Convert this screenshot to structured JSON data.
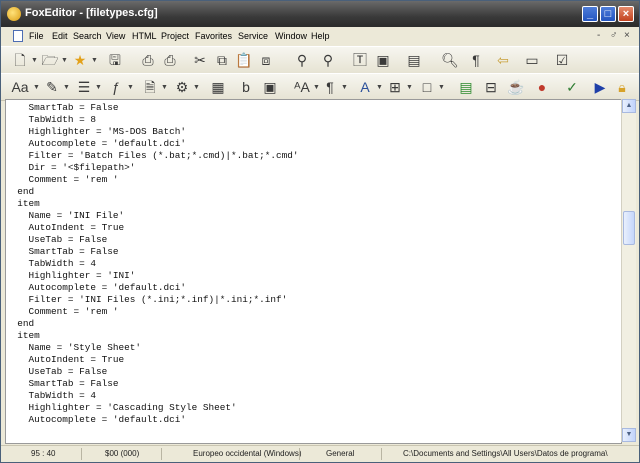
{
  "window": {
    "title": "FoxEditor - [filetypes.cfg]",
    "minimize_glyph": "_",
    "maximize_glyph": "□",
    "close_glyph": "×"
  },
  "menu": {
    "items": [
      "File",
      "Edit",
      "Search",
      "View",
      "HTML",
      "Project",
      "Favorites",
      "Service",
      "Window",
      "Help"
    ],
    "mdi_controls": [
      "-",
      "♂",
      "×"
    ]
  },
  "editor": {
    "lines": [
      "    SmartTab = False",
      "    TabWidth = 8",
      "    Highlighter = 'MS-DOS Batch'",
      "    Autocomplete = 'default.dci'",
      "    Filter = 'Batch Files (*.bat;*.cmd)|*.bat;*.cmd'",
      "    Dir = '<$filepath>'",
      "    Comment = 'rem '",
      "  end",
      "  item",
      "    Name = 'INI File'",
      "    AutoIndent = True",
      "    UseTab = False",
      "    SmartTab = False",
      "    TabWidth = 4",
      "    Highlighter = 'INI'",
      "    Autocomplete = 'default.dci'",
      "    Filter = 'INI Files (*.ini;*.inf)|*.ini;*.inf'",
      "    Comment = 'rem '",
      "  end",
      "  item",
      "    Name = 'Style Sheet'",
      "    AutoIndent = True",
      "    UseTab = False",
      "    SmartTab = False",
      "    TabWidth = 4",
      "    Highlighter = 'Cascading Style Sheet'",
      "    Autocomplete = 'default.dci'"
    ]
  },
  "status": {
    "position": "95 : 40",
    "char_code": "$00 (000)",
    "encoding": "Europeo occidental (Windows)",
    "syntax": "General",
    "path": "C:\\Documents and Settings\\All Users\\Datos de programa\\"
  },
  "icons": {
    "toolbar1": [
      "new-file-icon",
      "open-folder-icon",
      "favorites-star-icon",
      "save-icon",
      "print-preview-icon",
      "print-icon",
      "cut-icon",
      "copy-icon",
      "paste-icon",
      "paste-special-icon",
      "find-icon",
      "replace-icon",
      "text-mode-icon",
      "page-view-icon",
      "split-view-icon",
      "zoom-icon",
      "paragraph-marks-icon",
      "bookmark-icon",
      "folder-icon",
      "checklist-icon"
    ],
    "toolbar2": [
      "case-icon",
      "brush-icon",
      "list-icon",
      "function-icon",
      "document-icon",
      "tools-icon",
      "block-icon",
      "bold-b-icon",
      "save-all-icon",
      "font-size-icon",
      "paragraph-icon",
      "font-color-icon",
      "table-icon",
      "frame-icon",
      "image-icon",
      "layout-icon",
      "tea-icon",
      "colors-icon",
      "spellcheck-icon",
      "run-icon",
      "lock-icon"
    ]
  },
  "colors": {
    "titlebar": "#3a3a3a",
    "chrome": "#ece9d8",
    "close_button": "#c2421f"
  }
}
